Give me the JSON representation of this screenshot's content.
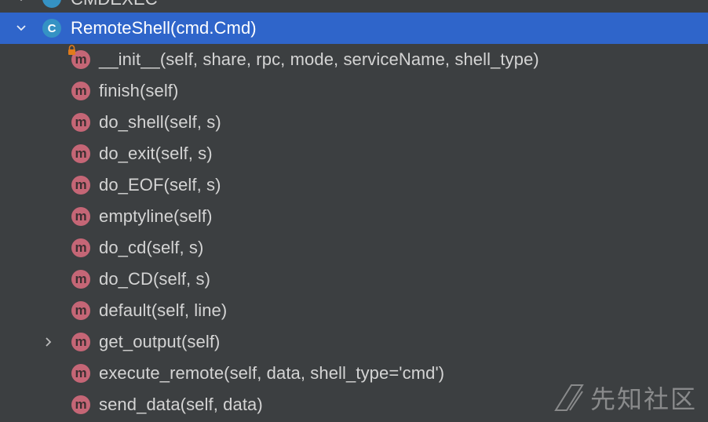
{
  "tree": {
    "top_row": {
      "label": "CMDEXEC",
      "icon": "class-icon"
    },
    "class_row": {
      "badge": "C",
      "label": "RemoteShell(cmd.Cmd)",
      "expanded": true,
      "selected": true
    },
    "methods": [
      {
        "label": "__init__(self, share, rpc, mode, serviceName, shell_type)",
        "badge": "m",
        "locked": true
      },
      {
        "label": "finish(self)",
        "badge": "m"
      },
      {
        "label": "do_shell(self, s)",
        "badge": "m"
      },
      {
        "label": "do_exit(self, s)",
        "badge": "m"
      },
      {
        "label": "do_EOF(self, s)",
        "badge": "m"
      },
      {
        "label": "emptyline(self)",
        "badge": "m"
      },
      {
        "label": "do_cd(self, s)",
        "badge": "m"
      },
      {
        "label": "do_CD(self, s)",
        "badge": "m"
      },
      {
        "label": "default(self, line)",
        "badge": "m"
      },
      {
        "label": "get_output(self)",
        "badge": "m",
        "collapsible": true
      },
      {
        "label": "execute_remote(self, data, shell_type='cmd')",
        "badge": "m"
      },
      {
        "label": "send_data(self, data)",
        "badge": "m"
      }
    ]
  },
  "watermark": {
    "text": "先知社区"
  },
  "colors": {
    "background": "#3c3f41",
    "selection": "#2f65ca",
    "class_badge": "#3592c4",
    "method_badge": "#c56676",
    "lock": "#e07b1b",
    "text": "#d4d4d4"
  }
}
